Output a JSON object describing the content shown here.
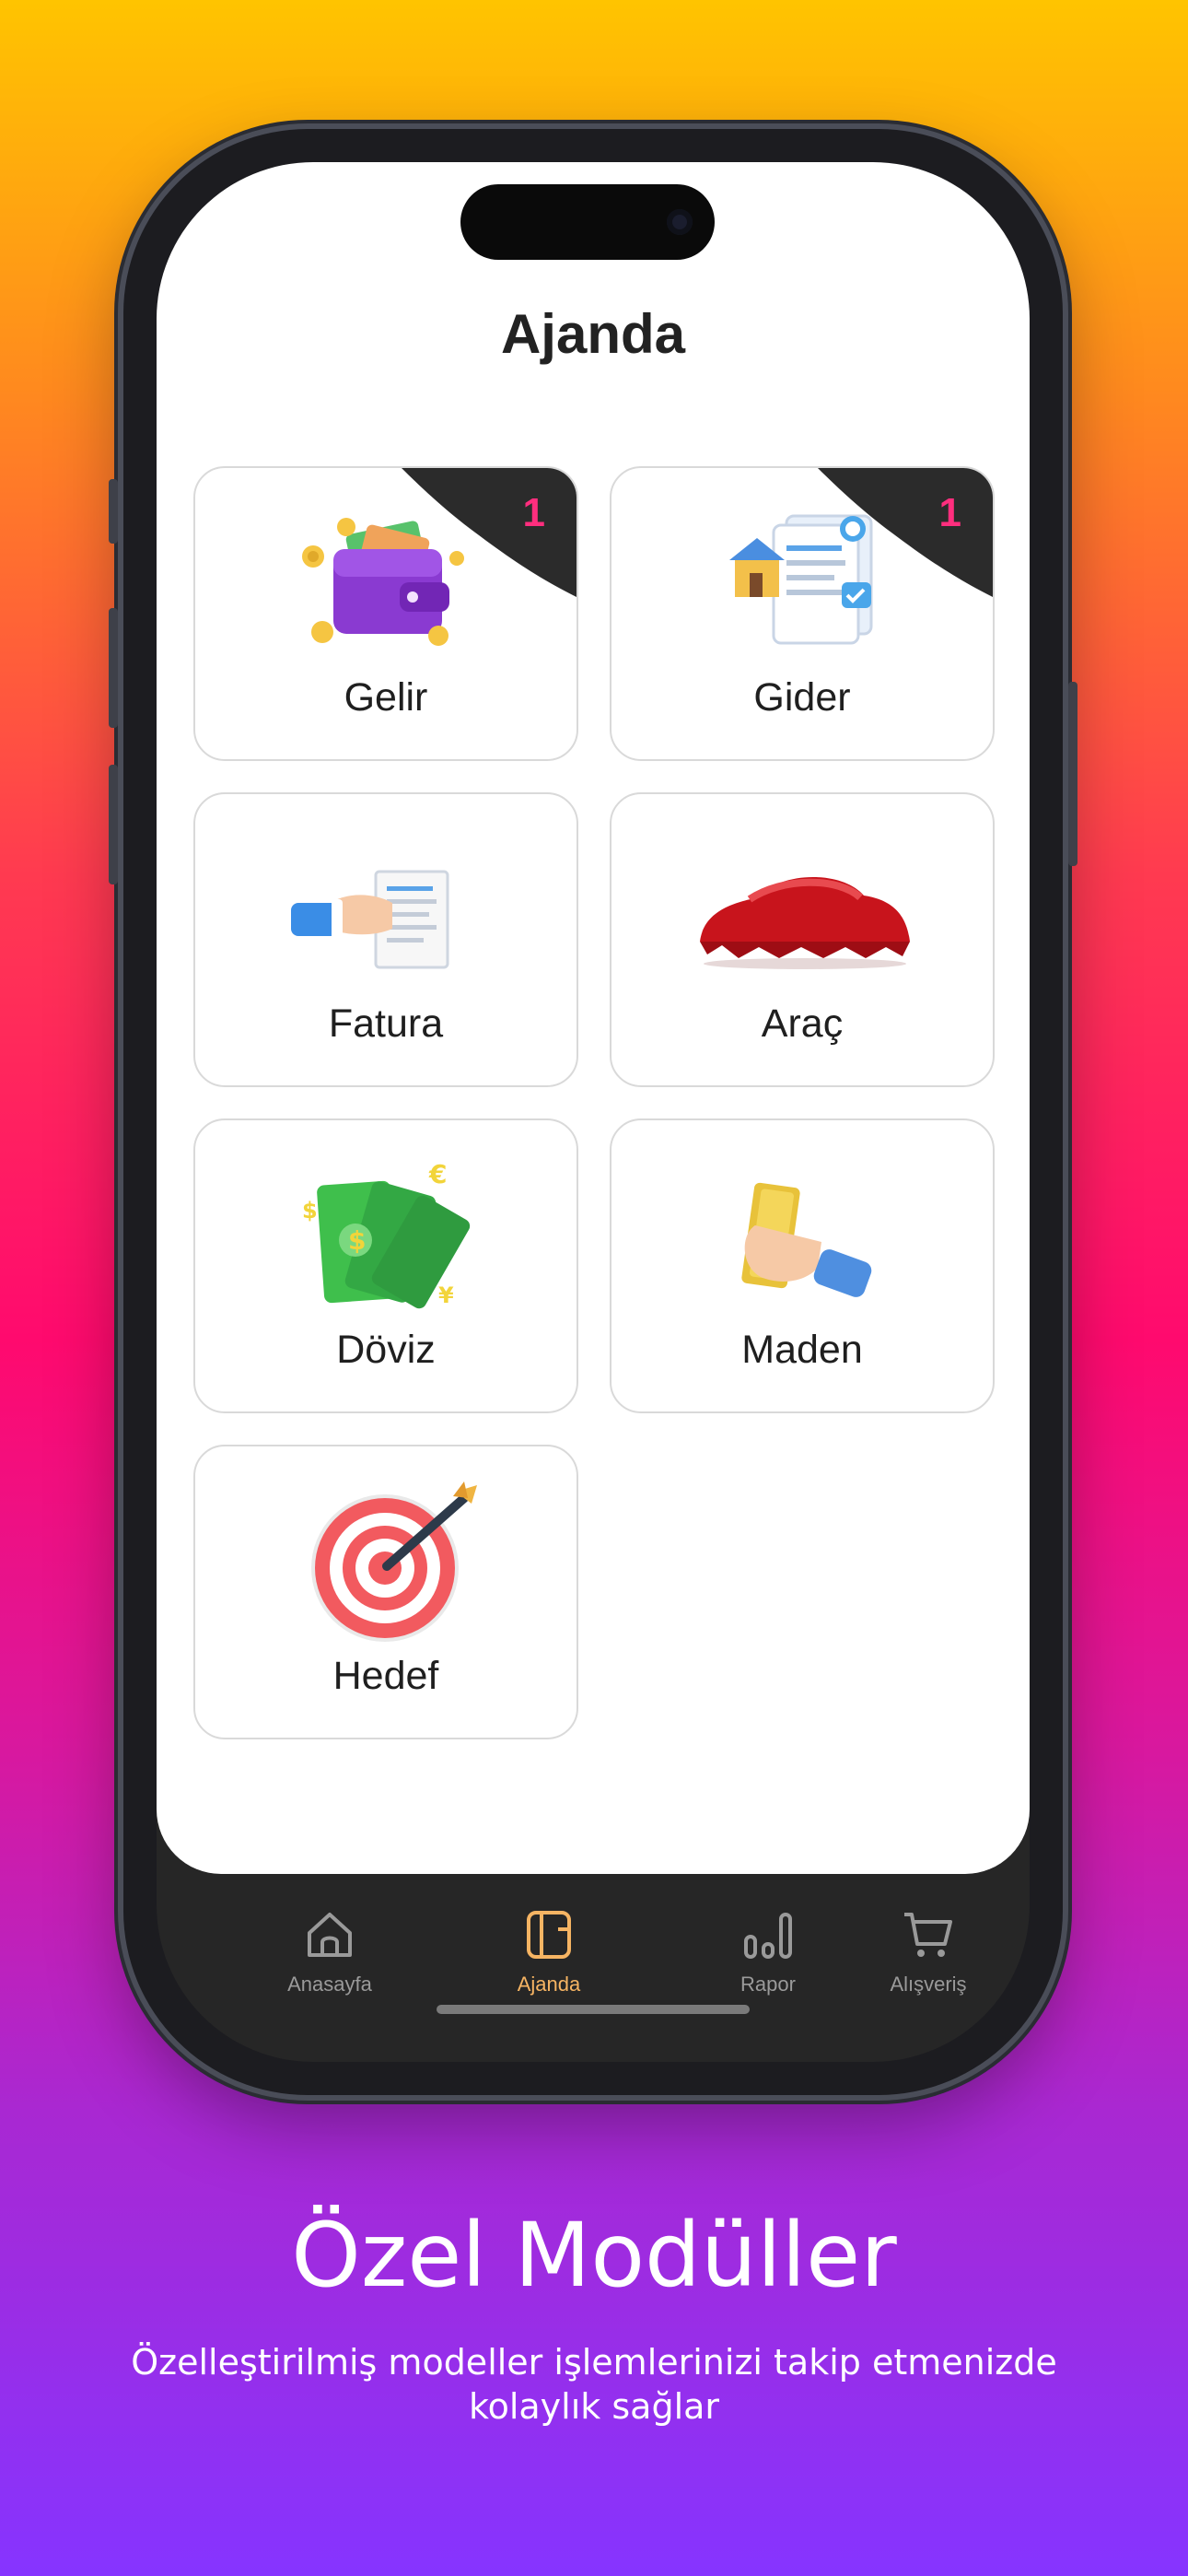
{
  "header": {
    "title": "Ajanda"
  },
  "modules": [
    {
      "label": "Gelir",
      "badge": "1",
      "icon": "wallet-icon"
    },
    {
      "label": "Gider",
      "badge": "1",
      "icon": "invoice-house-icon"
    },
    {
      "label": "Fatura",
      "icon": "bill-hand-icon"
    },
    {
      "label": "Araç",
      "icon": "covered-car-icon"
    },
    {
      "label": "Döviz",
      "icon": "currency-notes-icon"
    },
    {
      "label": "Maden",
      "icon": "gold-bar-icon"
    },
    {
      "label": "Hedef",
      "icon": "target-dart-icon"
    }
  ],
  "tabbar": {
    "tabs": [
      {
        "label": "Anasayfa",
        "icon": "home-icon",
        "active": false
      },
      {
        "label": "Ajanda",
        "icon": "agenda-icon",
        "active": true
      },
      {
        "label": "Rapor",
        "icon": "chart-icon",
        "active": false
      },
      {
        "label": "Alışveriş",
        "icon": "cart-icon",
        "active": false
      }
    ]
  },
  "promo": {
    "heading": "Özel Modüller",
    "subtext": "Özelleştirilmiş modeller işlemlerinizi takip etmenizde kolaylık sağlar"
  },
  "colors": {
    "badge": "#ff2e7e",
    "active_tab": "#f6b463",
    "tabbar_bg": "#262626"
  }
}
